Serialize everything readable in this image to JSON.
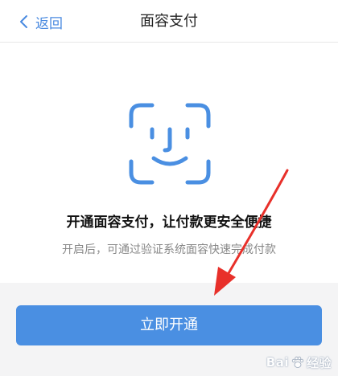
{
  "nav": {
    "back_label": "返回",
    "title": "面容支付"
  },
  "content": {
    "headline": "开通面容支付，让付款更安全便捷",
    "subtext": "开启后，可通过验证系统面容快速完成付款"
  },
  "action": {
    "button_label": "立即开通"
  },
  "watermark": {
    "text_left": "Bai",
    "text_right": "经验",
    "url": "jingyan.baidu.com"
  },
  "colors": {
    "accent": "#4a8fe2",
    "annotation_arrow": "#e8302a"
  },
  "icons": {
    "back": "chevron-left-icon",
    "face": "face-id-icon"
  }
}
